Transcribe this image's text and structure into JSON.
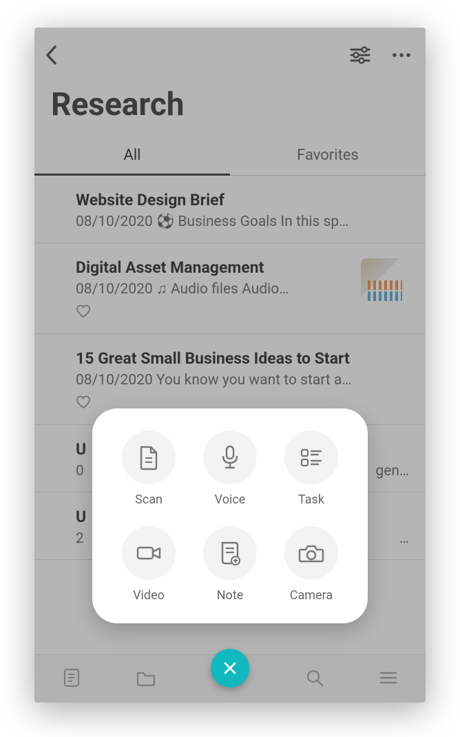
{
  "header": {
    "title": "Research"
  },
  "tabs": [
    {
      "label": "All",
      "active": true
    },
    {
      "label": "Favorites",
      "active": false
    }
  ],
  "items": [
    {
      "title": "Website Design Brief",
      "date": "08/10/2020",
      "glyph": "⚽",
      "preview": "Business Goals  In this sp…",
      "favorite": false,
      "thumb": false
    },
    {
      "title": "Digital Asset Management",
      "date": "08/10/2020",
      "glyph": "♫",
      "preview": "Audio files  Audio…",
      "favorite": true,
      "thumb": true
    },
    {
      "title": "15 Great Small Business Ideas to Start",
      "date": "08/10/2020",
      "glyph": "",
      "preview": "You know you want to start a…",
      "favorite": true,
      "thumb": false
    },
    {
      "title": "U",
      "date": "0",
      "glyph": "",
      "preview": "gen…",
      "favorite": false,
      "thumb": false
    },
    {
      "title": "U",
      "date": "2",
      "glyph": "",
      "preview": "…",
      "favorite": false,
      "thumb": false
    }
  ],
  "actions": [
    {
      "label": "Scan"
    },
    {
      "label": "Voice"
    },
    {
      "label": "Task"
    },
    {
      "label": "Video"
    },
    {
      "label": "Note"
    },
    {
      "label": "Camera"
    }
  ]
}
